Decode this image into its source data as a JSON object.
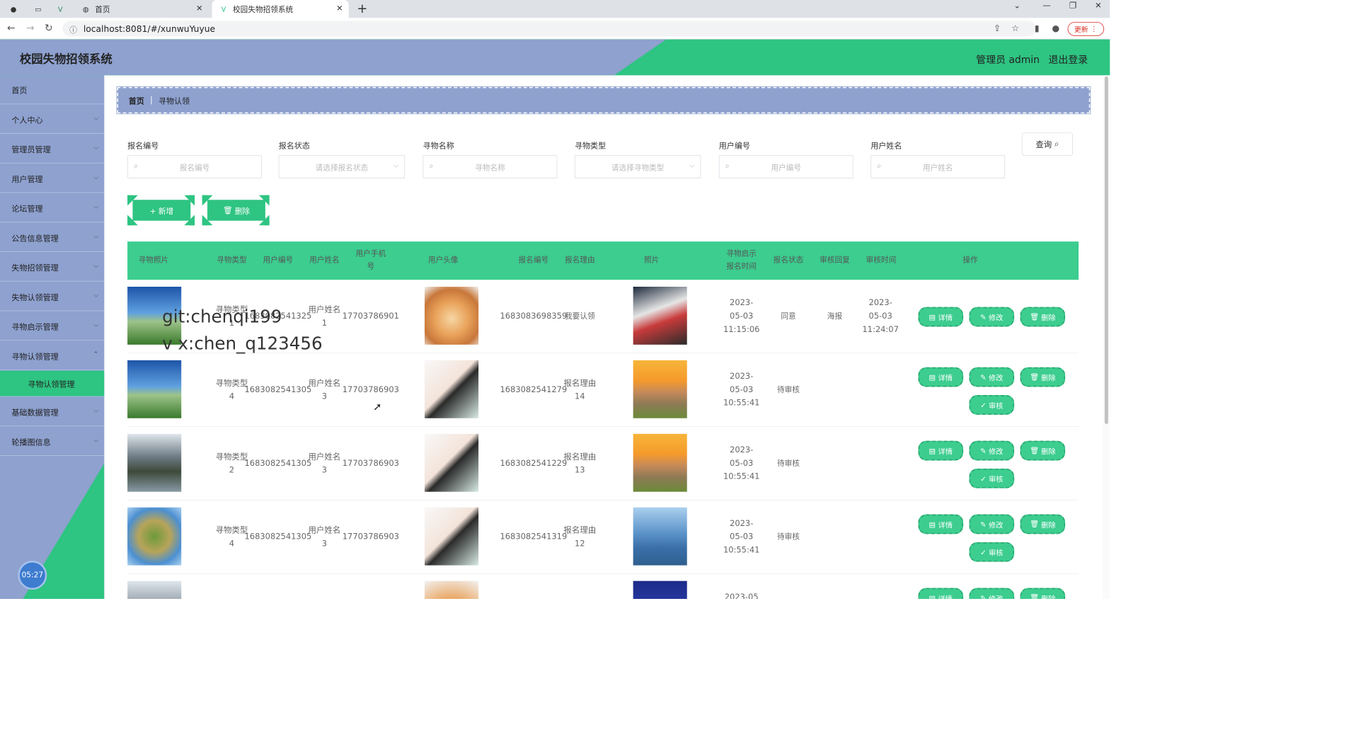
{
  "browser": {
    "tabs": [
      {
        "label": "首页",
        "icon": "globe-icon"
      },
      {
        "label": "校园失物招领系统",
        "icon": "vue-logo-icon"
      }
    ],
    "url": "localhost:8081/#/xunwuYuyue",
    "update_label": "更新"
  },
  "header": {
    "title": "校园失物招领系统",
    "user": "管理员 admin",
    "logout": "退出登录"
  },
  "sidebar": {
    "items": [
      {
        "label": "首页"
      },
      {
        "label": "个人中心"
      },
      {
        "label": "管理员管理"
      },
      {
        "label": "用户管理"
      },
      {
        "label": "论坛管理"
      },
      {
        "label": "公告信息管理"
      },
      {
        "label": "失物招领管理"
      },
      {
        "label": "失物认领管理"
      },
      {
        "label": "寻物启示管理"
      },
      {
        "label": "寻物认领管理"
      },
      {
        "label": "寻物认领管理"
      },
      {
        "label": "基础数据管理"
      },
      {
        "label": "轮播图信息"
      }
    ],
    "clock": "05:27"
  },
  "breadcrumb": {
    "home": "首页",
    "current": "寻物认领"
  },
  "filters": [
    {
      "label": "报名编号",
      "placeholder": "报名编号"
    },
    {
      "label": "报名状态",
      "placeholder": "请选择报名状态"
    },
    {
      "label": "寻物名称",
      "placeholder": "寻物名称"
    },
    {
      "label": "寻物类型",
      "placeholder": "请选择寻物类型"
    },
    {
      "label": "用户编号",
      "placeholder": "用户编号"
    },
    {
      "label": "用户姓名",
      "placeholder": "用户姓名"
    }
  ],
  "query_label": "查询",
  "actions": {
    "add": "+ 新增",
    "delete": "删除"
  },
  "columns": [
    "寻物照片",
    "寻物类型",
    "用户编号",
    "用户姓名",
    "用户手机号",
    "用户头像",
    "报名编号",
    "报名理由",
    "照片",
    "寻物启示报名时间",
    "报名状态",
    "审核回复",
    "审核时间",
    "操作"
  ],
  "rows": [
    {
      "type": "寻物类型1",
      "user_no": "1683082541325",
      "user_name": "用户姓名1",
      "phone": "17703786901",
      "sign_no": "1683083698359",
      "reason": "我要认领",
      "time": "2023-05-03 11:15:06",
      "status": "同意",
      "reply": "海报",
      "audit_time": "2023-05-03 11:24:07"
    },
    {
      "type": "寻物类型4",
      "user_no": "1683082541305",
      "user_name": "用户姓名3",
      "phone": "17703786903",
      "sign_no": "1683082541279",
      "reason": "报名理由14",
      "time": "2023-05-03 10:55:41",
      "status": "待审核",
      "reply": "",
      "audit_time": ""
    },
    {
      "type": "寻物类型2",
      "user_no": "1683082541305",
      "user_name": "用户姓名3",
      "phone": "17703786903",
      "sign_no": "1683082541229",
      "reason": "报名理由13",
      "time": "2023-05-03 10:55:41",
      "status": "待审核",
      "reply": "",
      "audit_time": ""
    },
    {
      "type": "寻物类型4",
      "user_no": "1683082541305",
      "user_name": "用户姓名3",
      "phone": "17703786903",
      "sign_no": "1683082541319",
      "reason": "报名理由12",
      "time": "2023-05-03 10:55:41",
      "status": "待审核",
      "reply": "",
      "audit_time": ""
    },
    {
      "type": "",
      "user_no": "",
      "user_name": "",
      "phone": "",
      "sign_no": "",
      "reason": "",
      "time": "2023-05",
      "status": "",
      "reply": "",
      "audit_time": ""
    }
  ],
  "op_labels": {
    "detail": "详情",
    "edit": "修改",
    "delete": "删除",
    "audit": "审核"
  },
  "watermark": [
    "git:chenqi199",
    "v x:chen_q123456"
  ],
  "colors": {
    "accent": "#2ec482",
    "sidebar": "#8ea1cf",
    "table_header": "#3ccd8f"
  }
}
